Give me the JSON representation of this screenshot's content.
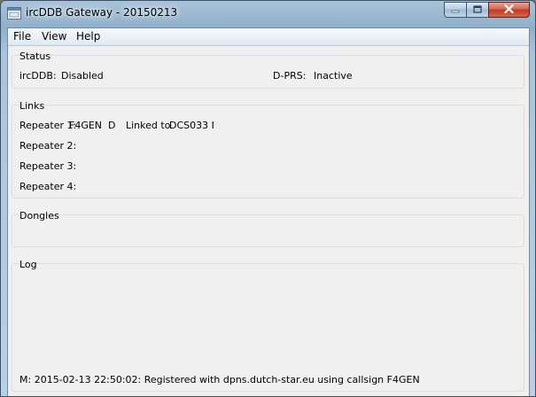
{
  "window": {
    "title": "ircDDB Gateway - 20150213"
  },
  "menu": {
    "items": [
      "File",
      "View",
      "Help"
    ]
  },
  "status": {
    "label": "Status",
    "ircddb_label": "ircDDB:",
    "ircddb_value": "Disabled",
    "dprs_label": "D-PRS:",
    "dprs_value": "Inactive"
  },
  "links": {
    "label": "Links",
    "repeaters": [
      {
        "label": "Repeater 1:",
        "callsign": "F4GEN  D",
        "linked_text": "Linked to",
        "reflector": "DCS033 I"
      },
      {
        "label": "Repeater 2:",
        "callsign": "",
        "linked_text": "",
        "reflector": ""
      },
      {
        "label": "Repeater 3:",
        "callsign": "",
        "linked_text": "",
        "reflector": ""
      },
      {
        "label": "Repeater 4:",
        "callsign": "",
        "linked_text": "",
        "reflector": ""
      }
    ]
  },
  "dongles": {
    "label": "Dongles"
  },
  "log": {
    "label": "Log",
    "lines": [
      "M: 2015-02-13 22:50:02: Registered with dpns.dutch-star.eu using callsign F4GEN"
    ]
  }
}
